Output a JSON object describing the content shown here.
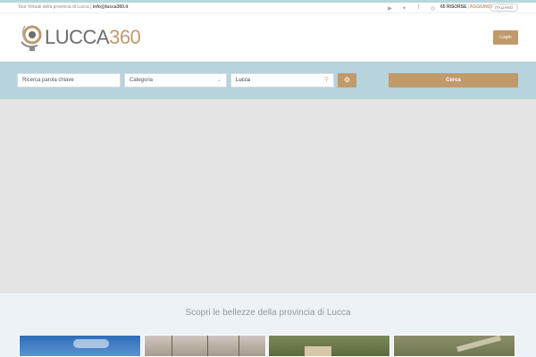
{
  "topbar": {
    "info_text": "Tour Virtuali della provincia di Lucca |",
    "email": "info@lucca360.it",
    "socials": [
      {
        "icon": "youtube-icon",
        "glyph": "▶"
      },
      {
        "icon": "twitter-icon",
        "glyph": "✦"
      },
      {
        "icon": "facebook-icon",
        "glyph": "f"
      },
      {
        "icon": "instagram-icon",
        "glyph": "◎"
      }
    ],
    "listing_count": "65 RISORSE",
    "listing_add": "AGGIUNGI",
    "language": "ITALIANO"
  },
  "header": {
    "logo_text": "LUCCA",
    "logo_num": "360",
    "login_label": "Login"
  },
  "search": {
    "keyword_placeholder": "Ricerca parola chiave",
    "category_label": "Categoria",
    "location_value": "Lucca",
    "submit_label": "Cerca"
  },
  "section": {
    "title": "Scopri le bellezze della provincia di Lucca"
  },
  "colors": {
    "accent": "#c09a6b",
    "searchbar_bg": "#b7d3dc",
    "map_bg": "#e5e5e5",
    "section_bg": "#edf2f6"
  }
}
